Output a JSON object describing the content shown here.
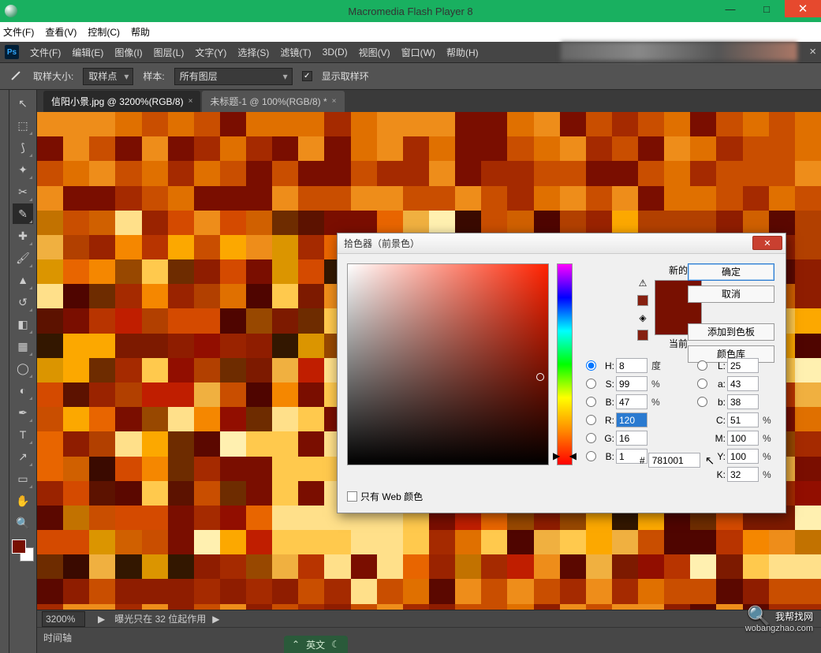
{
  "outer_window": {
    "title": "Macromedia Flash Player 8",
    "menu": [
      "文件(F)",
      "查看(V)",
      "控制(C)",
      "帮助"
    ]
  },
  "ps_menu": [
    "文件(F)",
    "编辑(E)",
    "图像(I)",
    "图层(L)",
    "文字(Y)",
    "选择(S)",
    "滤镜(T)",
    "3D(D)",
    "视图(V)",
    "窗口(W)",
    "帮助(H)"
  ],
  "options_bar": {
    "sample_size_label": "取样大小:",
    "sample_size_value": "取样点",
    "sample_label": "样本:",
    "sample_value": "所有图层",
    "show_ring_label": "显示取样环"
  },
  "doc_tabs": [
    {
      "label": "信阳小景.jpg @ 3200%(RGB/8)",
      "active": true
    },
    {
      "label": "未标题-1 @ 100%(RGB/8) *",
      "active": false
    }
  ],
  "status": {
    "zoom": "3200%",
    "exposure_msg": "曝光只在 32 位起作用",
    "timeline_label": "时间轴",
    "ime_lang": "英文"
  },
  "color_picker": {
    "title": "拾色器（前景色）",
    "new_label": "新的",
    "current_label": "当前",
    "buttons": {
      "ok": "确定",
      "cancel": "取消",
      "add": "添加到色板",
      "lib": "颜色库"
    },
    "hsb": {
      "h": "8",
      "h_unit": "度",
      "s": "99",
      "b": "47"
    },
    "lab": {
      "l": "25",
      "a": "43",
      "b": "38"
    },
    "rgb": {
      "r": "120",
      "g": "16",
      "b": "1"
    },
    "cmyk": {
      "c": "51",
      "m": "100",
      "y": "100",
      "k": "32"
    },
    "hex": "781001",
    "web_only_label": "只有 Web 颜色",
    "labels": {
      "H": "H:",
      "S": "S:",
      "B": "B:",
      "L": "L:",
      "a": "a:",
      "b": "b:",
      "R": "R:",
      "G": "G:",
      "Bv": "B:",
      "C": "C:",
      "M": "M:",
      "Y": "Y:",
      "K": "K:",
      "hash": "#",
      "pct": "%"
    }
  },
  "watermark": {
    "text": "我帮找网",
    "url": "wobangzhao.com"
  },
  "tools": [
    "move",
    "marquee",
    "lasso",
    "wand",
    "crop",
    "eyedropper",
    "heal",
    "brush",
    "stamp",
    "history",
    "eraser",
    "gradient",
    "blur",
    "dodge",
    "pen",
    "text",
    "path",
    "shape",
    "hand",
    "zoom"
  ],
  "canvas_palette": [
    "#3a0a00",
    "#5c1200",
    "#7d1a00",
    "#9a2300",
    "#b83400",
    "#d44a00",
    "#e86500",
    "#f58700",
    "#fca800",
    "#ffc94d",
    "#ffe08a",
    "#7a0e00",
    "#a52a00",
    "#c94e00",
    "#e07000",
    "#ee8d1a",
    "#5b0800",
    "#8f1d00",
    "#b24000",
    "#d06000",
    "#331700",
    "#6e2c00",
    "#984800",
    "#c27200",
    "#db9500",
    "#f0b040",
    "#fff0b0",
    "#4f0500",
    "#920e00",
    "#c01e00"
  ]
}
